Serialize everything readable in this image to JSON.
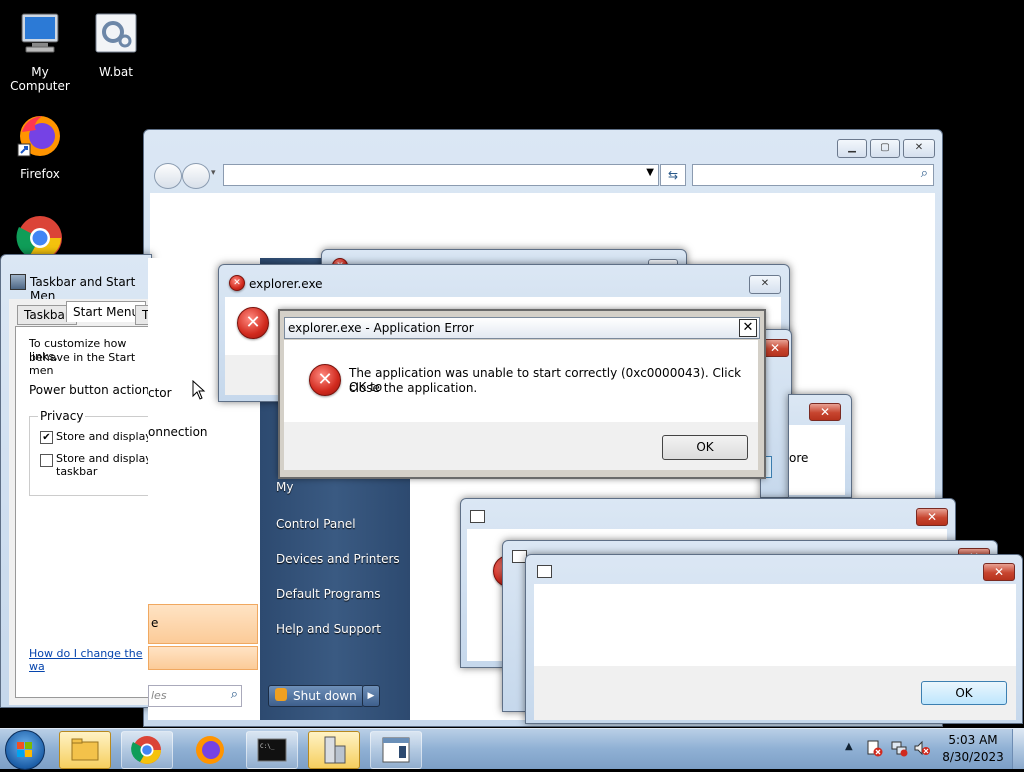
{
  "desktop": {
    "icons": [
      {
        "label": "My Computer",
        "icon": "computer-icon"
      },
      {
        "label": "W.bat",
        "icon": "batch-file-icon"
      },
      {
        "label": "Firefox",
        "icon": "firefox-icon"
      },
      {
        "label": "",
        "icon": "chrome-icon"
      }
    ]
  },
  "explorer_window": {
    "address_value": "",
    "search_placeholder": ""
  },
  "taskbar_properties": {
    "title": "Taskbar and Start Men",
    "tabs": [
      "Taskbar",
      "Start Menu",
      "T"
    ],
    "intro_line1": "To customize how links,",
    "intro_line2": "behave in the Start men",
    "power_label": "Power button action:",
    "privacy_legend": "Privacy",
    "privacy_opt1": "Store and display r",
    "privacy_opt2_line1": "Store and display r",
    "privacy_opt2_line2": "taskbar",
    "help_link": "How do I change the wa"
  },
  "start_menu": {
    "left_item1": "ctor",
    "left_item2": "onnection",
    "left_item3": "e",
    "search_placeholder": "les",
    "right_items": [
      "My",
      "Control Panel",
      "Devices and Printers",
      "Default Programs",
      "Help and Support"
    ],
    "shutdown_label": "Shut down"
  },
  "explorer_error_back": {
    "title": "explorer.exe"
  },
  "app_error": {
    "title": "explorer.exe - Application Error",
    "message_line1": "The application was unable to start correctly (0xc0000043). Click OK to",
    "message_line2": "close the application.",
    "ok_label": "OK"
  },
  "side_dialog": {
    "partial_text": "ore"
  },
  "bottom_dialog": {
    "ok_label": "OK"
  },
  "clock": {
    "time": "5:03 AM",
    "date": "8/30/2023"
  },
  "colors": {
    "error_red": "#d12a1e",
    "aero_blue": "#c6d8ec",
    "link_blue": "#0645ad"
  }
}
